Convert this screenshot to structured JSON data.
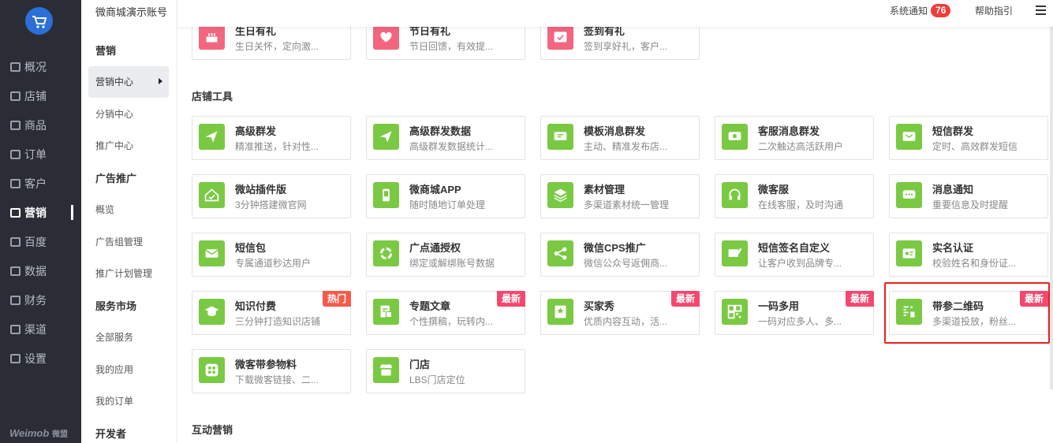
{
  "app": {
    "account_name": "微商城演示账号",
    "brand": "Weimob",
    "brand_sub": "微盟"
  },
  "nav": [
    {
      "label": "概况",
      "icon": "overview-icon"
    },
    {
      "label": "店铺",
      "icon": "store-icon"
    },
    {
      "label": "商品",
      "icon": "goods-icon"
    },
    {
      "label": "订单",
      "icon": "order-icon"
    },
    {
      "label": "客户",
      "icon": "customer-icon"
    },
    {
      "label": "营销",
      "icon": "marketing-icon",
      "active": true
    },
    {
      "label": "百度",
      "icon": "baidu-icon"
    },
    {
      "label": "数据",
      "icon": "data-icon"
    },
    {
      "label": "财务",
      "icon": "finance-icon"
    },
    {
      "label": "渠道",
      "icon": "channel-icon"
    },
    {
      "label": "设置",
      "icon": "settings-icon"
    }
  ],
  "subnav": [
    {
      "label": "营销",
      "type": "head"
    },
    {
      "label": "营销中心",
      "type": "active"
    },
    {
      "label": "分销中心",
      "type": "item"
    },
    {
      "label": "推广中心",
      "type": "item"
    },
    {
      "label": "广告推广",
      "type": "head"
    },
    {
      "label": "概览",
      "type": "item"
    },
    {
      "label": "广告组管理",
      "type": "item"
    },
    {
      "label": "推广计划管理",
      "type": "item"
    },
    {
      "label": "服务市场",
      "type": "head"
    },
    {
      "label": "全部服务",
      "type": "item"
    },
    {
      "label": "我的应用",
      "type": "item"
    },
    {
      "label": "我的订单",
      "type": "item"
    },
    {
      "label": "开发者",
      "type": "head"
    }
  ],
  "topbar": {
    "notice_label": "系统通知",
    "notice_count": "76",
    "help_label": "帮助指引"
  },
  "sections": {
    "store_tools": "店铺工具",
    "interactive": "互动营销"
  },
  "top_cards": [
    {
      "title": "生日有礼",
      "desc": "生日关怀，定向激...",
      "icon": "birthday-cake-icon"
    },
    {
      "title": "节日有礼",
      "desc": "节日回馈，有效提...",
      "icon": "heart-gift-icon"
    },
    {
      "title": "签到有礼",
      "desc": "签到享好礼，客户...",
      "icon": "calendar-check-icon"
    }
  ],
  "tool_cards": [
    {
      "title": "高级群发",
      "desc": "精准推送，针对性...",
      "icon": "send-plane-icon"
    },
    {
      "title": "高级群发数据",
      "desc": "高级群发数据统计...",
      "icon": "send-plane-icon"
    },
    {
      "title": "模板消息群发",
      "desc": "主动、精准发布店...",
      "icon": "template-message-icon"
    },
    {
      "title": "客服消息群发",
      "desc": "二次触达高活跃用户",
      "icon": "service-message-icon"
    },
    {
      "title": "短信群发",
      "desc": "定时、高效群发短信",
      "icon": "sms-icon"
    },
    {
      "title": "微站插件版",
      "desc": "3分钟搭建微官网",
      "icon": "house-icon"
    },
    {
      "title": "微商城APP",
      "desc": "随时随地订单处理",
      "icon": "phone-app-icon"
    },
    {
      "title": "素材管理",
      "desc": "多渠道素材统一管理",
      "icon": "layers-icon"
    },
    {
      "title": "微客服",
      "desc": "在线客服，及时沟通",
      "icon": "headset-icon"
    },
    {
      "title": "消息通知",
      "desc": "重要信息及时提醒",
      "icon": "chat-bubble-icon"
    },
    {
      "title": "短信包",
      "desc": "专属通道秒达用户",
      "icon": "envelope-icon"
    },
    {
      "title": "广点通授权",
      "desc": "绑定或解绑账号数据",
      "icon": "ring-icon"
    },
    {
      "title": "微信CPS推广",
      "desc": "微信公众号返佣商...",
      "icon": "share-nodes-icon"
    },
    {
      "title": "短信签名自定义",
      "desc": "让客户收到品牌专...",
      "icon": "envelope-pen-icon"
    },
    {
      "title": "实名认证",
      "desc": "校验姓名和身份证...",
      "icon": "id-card-icon"
    },
    {
      "title": "知识付费",
      "desc": "三分钟打造知识店铺",
      "icon": "graduation-cap-icon",
      "tag": "热门",
      "tag_type": "hot"
    },
    {
      "title": "专题文章",
      "desc": "个性撰稿，玩转内...",
      "icon": "article-icon",
      "tag": "最新",
      "tag_type": "new"
    },
    {
      "title": "买家秀",
      "desc": "优质内容互动，活...",
      "icon": "buyer-show-icon",
      "tag": "最新",
      "tag_type": "new"
    },
    {
      "title": "一码多用",
      "desc": "一码对应多人、多...",
      "icon": "qr-code-icon",
      "tag": "最新",
      "tag_type": "new"
    },
    {
      "title": "带参二维码",
      "desc": "多渠道投放，粉丝...",
      "icon": "param-qrcode-icon",
      "tag": "最新",
      "tag_type": "new"
    },
    {
      "title": "微客带参物料",
      "desc": "下载微客链接、二...",
      "icon": "material-icon"
    },
    {
      "title": "门店",
      "desc": "LBS门店定位",
      "icon": "shop-front-icon"
    }
  ]
}
